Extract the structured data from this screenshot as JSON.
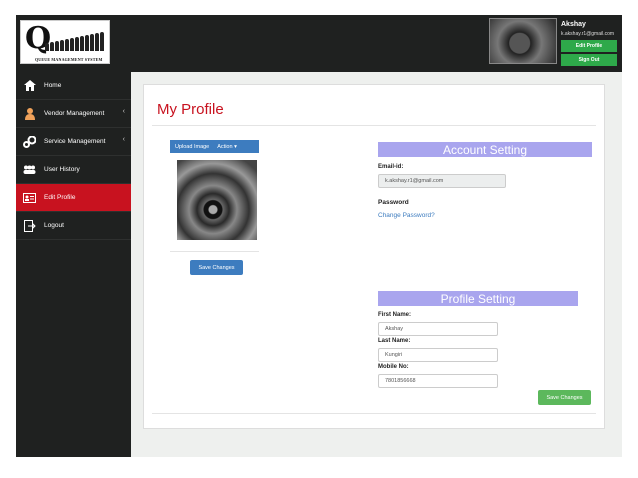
{
  "header": {
    "logo_letter": "Q",
    "logo_text": "QUEUE MANAGEMENT SYSTEM",
    "user_name": "Akshay",
    "user_email": "k.akshay.r1@gmail.com",
    "edit_profile_label": "Edit Profile",
    "sign_out_label": "Sign Out"
  },
  "sidebar": {
    "items": [
      {
        "label": "Home",
        "icon": "home-icon"
      },
      {
        "label": "Vendor Management",
        "icon": "user-icon"
      },
      {
        "label": "Service Management",
        "icon": "cogs-icon"
      },
      {
        "label": "User History",
        "icon": "users-icon"
      },
      {
        "label": "Edit Profile",
        "icon": "id-card-icon"
      },
      {
        "label": "Logout",
        "icon": "logout-icon"
      }
    ],
    "chevron": "‹"
  },
  "main": {
    "title": "My Profile",
    "upload_label": "Upload Image",
    "action_label": "Action ▾",
    "save_changes_label": "Save Changes",
    "account": {
      "title": "Account Setting",
      "email_label": "Email-id:",
      "email_value": "k.akshay.r1@gmail.com",
      "password_label": "Password",
      "change_password_label": "Change Password?"
    },
    "profile": {
      "title": "Profile Setting",
      "first_name_label": "First Name:",
      "first_name_value": "Akshay",
      "last_name_label": "Last Name:",
      "last_name_value": "Kungiri",
      "mobile_label": "Mobile No:",
      "mobile_value": "7801856668",
      "save_label": "Save Changes"
    }
  },
  "colors": {
    "accent_red": "#c8121f",
    "sidebar_bg": "#1f2120",
    "primary_blue": "#3d7cbf",
    "success_green": "#5cb85c",
    "section_purple": "#a9a5ee"
  }
}
